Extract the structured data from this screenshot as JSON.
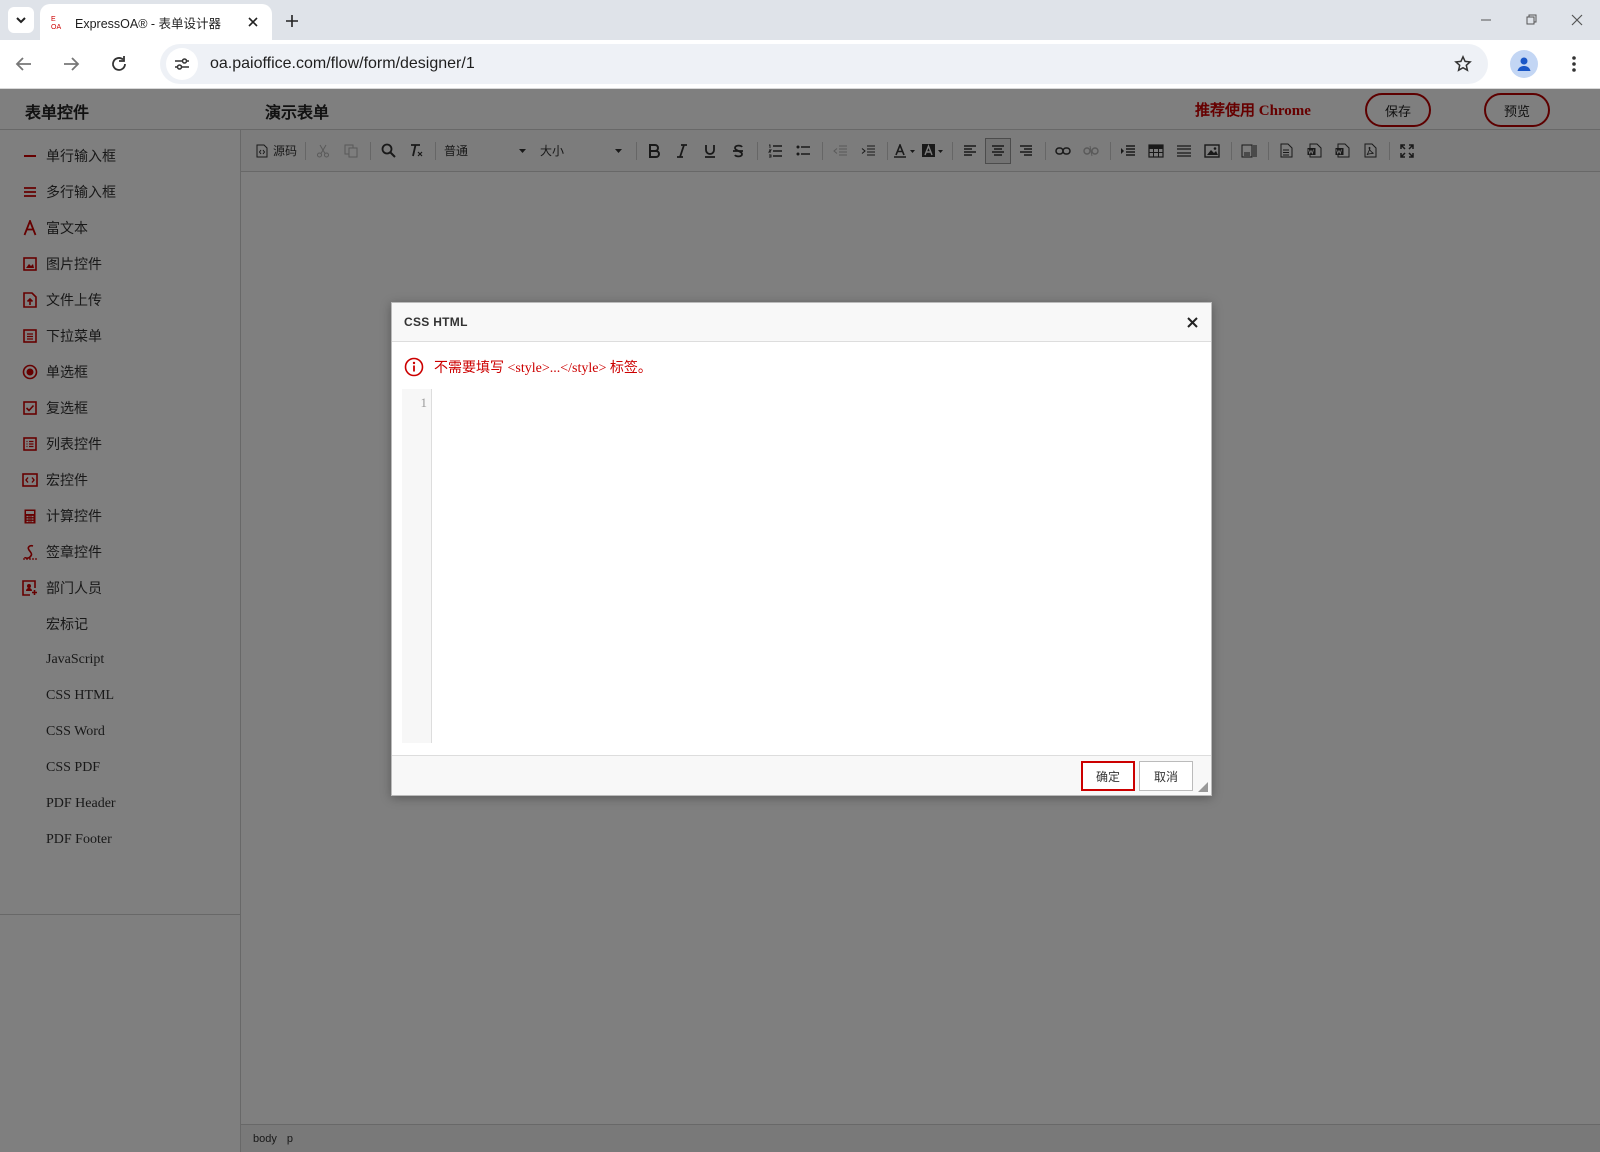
{
  "browser": {
    "tab_title": "ExpressOA® - 表单设计器",
    "url": "oa.paioffice.com/flow/form/designer/1",
    "favicon_text_top": "E",
    "favicon_text_bottom": "OA"
  },
  "header": {
    "sidebar_title": "表单控件",
    "form_title": "演示表单",
    "recommend": "推荐使用 Chrome",
    "save_label": "保存",
    "preview_label": "预览"
  },
  "sidebar": {
    "items": [
      {
        "label": "单行输入框",
        "icon": "single-line-icon"
      },
      {
        "label": "多行输入框",
        "icon": "multi-line-icon"
      },
      {
        "label": "富文本",
        "icon": "rich-text-icon"
      },
      {
        "label": "图片控件",
        "icon": "image-icon"
      },
      {
        "label": "文件上传",
        "icon": "upload-icon"
      },
      {
        "label": "下拉菜单",
        "icon": "dropdown-icon"
      },
      {
        "label": "单选框",
        "icon": "radio-icon"
      },
      {
        "label": "复选框",
        "icon": "checkbox-icon"
      },
      {
        "label": "列表控件",
        "icon": "list-icon"
      },
      {
        "label": "宏控件",
        "icon": "macro-icon"
      },
      {
        "label": "计算控件",
        "icon": "calculator-icon"
      },
      {
        "label": "签章控件",
        "icon": "signature-icon"
      },
      {
        "label": "部门人员",
        "icon": "department-icon"
      },
      {
        "label": "宏标记"
      },
      {
        "label": "JavaScript"
      },
      {
        "label": "CSS HTML"
      },
      {
        "label": "CSS Word"
      },
      {
        "label": "CSS PDF"
      },
      {
        "label": "PDF Header"
      },
      {
        "label": "PDF Footer"
      }
    ]
  },
  "editor": {
    "source_label": "源码",
    "format_value": "普通",
    "size_value": "大小",
    "status_path": [
      "body",
      "p"
    ]
  },
  "dialog": {
    "title": "CSS HTML",
    "warning": "不需要填写 <style>...</style> 标签。",
    "line_number": "1",
    "code": "",
    "ok_label": "确定",
    "cancel_label": "取消"
  },
  "colors": {
    "accent": "#cc0000",
    "overlay": "rgba(0,0,0,0.5)"
  }
}
